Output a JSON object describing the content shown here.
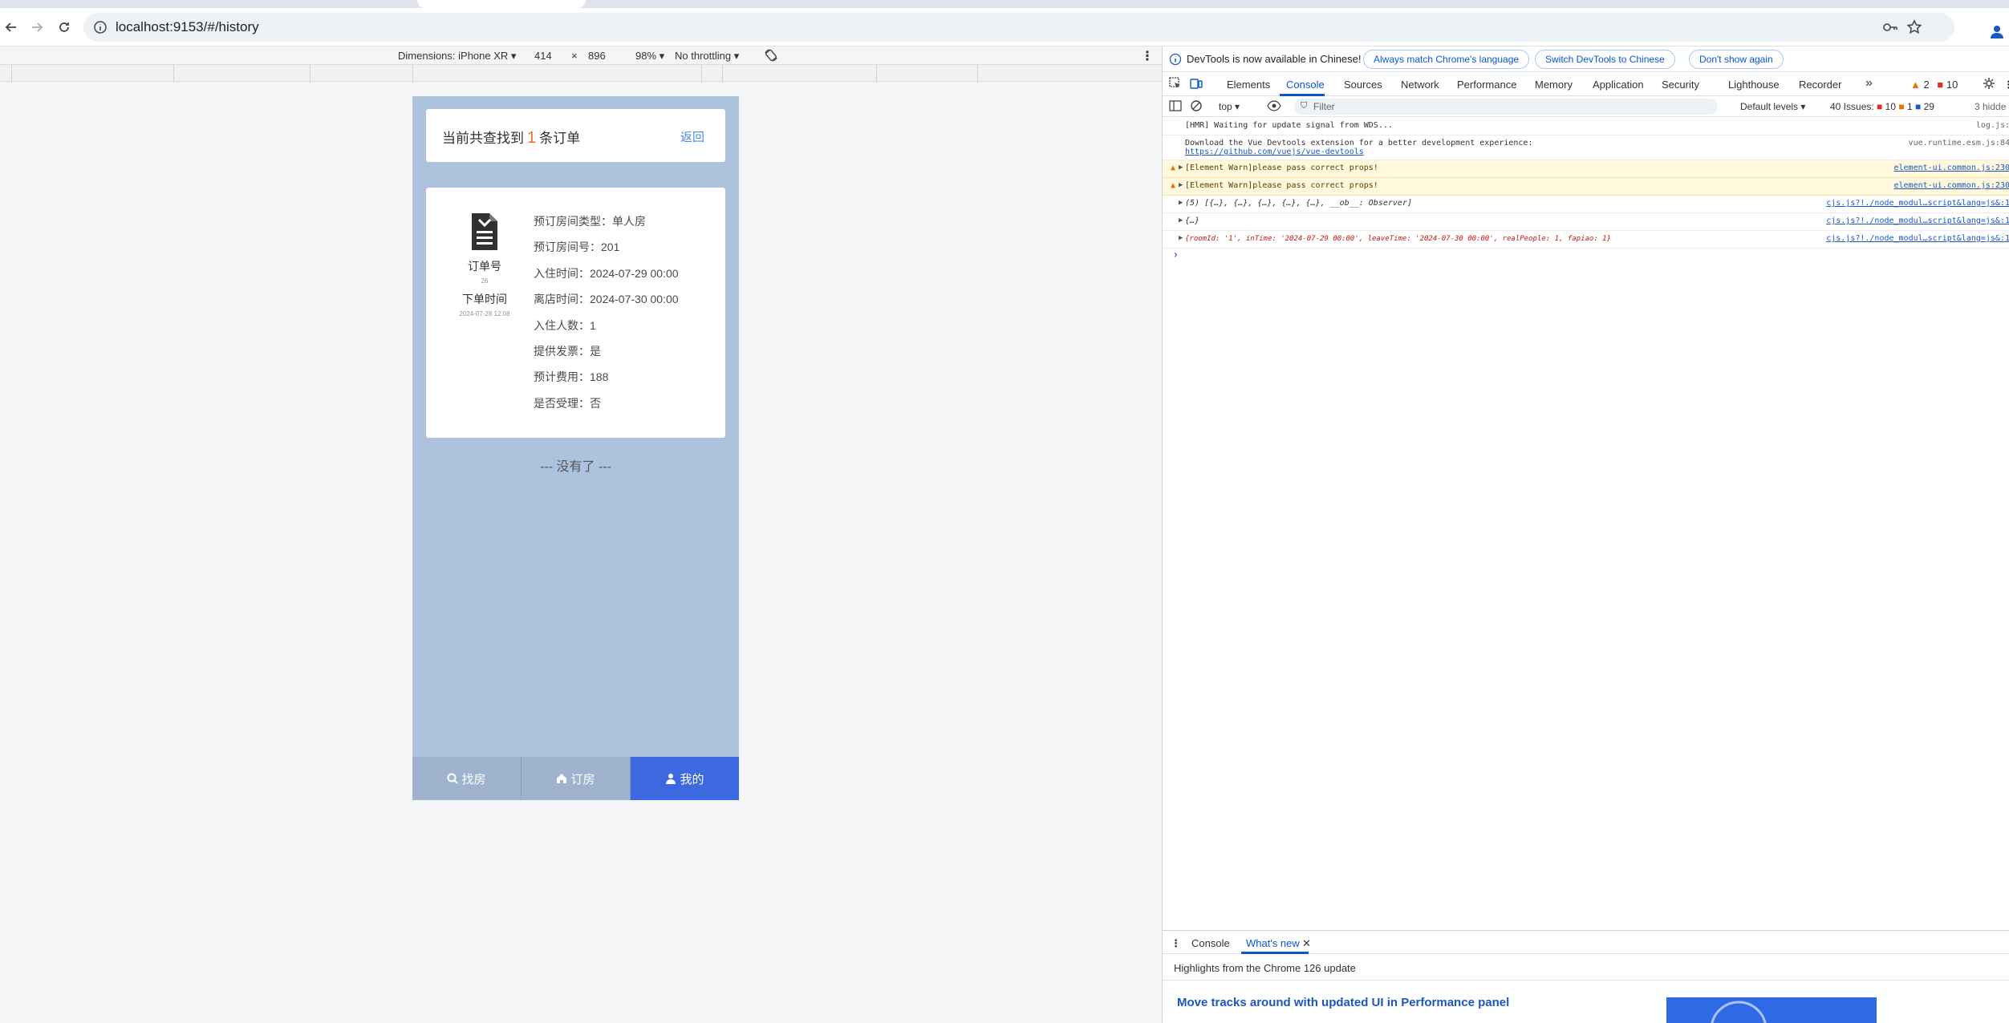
{
  "browser": {
    "url": "localhost:9153/#/history"
  },
  "device_toolbar": {
    "dimensions_label": "Dimensions: iPhone XR",
    "width": "414",
    "times": "×",
    "height": "896",
    "zoom": "98%",
    "throttling": "No throttling"
  },
  "app": {
    "summary_prefix": "当前共查找到",
    "summary_count": "1",
    "summary_suffix": "条订单",
    "back_link": "返回",
    "order": {
      "order_no_label": "订单号",
      "order_no_value": "26",
      "order_time_label": "下单时间",
      "order_time_value": "2024-07-28 12:08",
      "fields": [
        {
          "label": "预订房间类型：",
          "value": "单人房"
        },
        {
          "label": "预订房间号：",
          "value": "201"
        },
        {
          "label": "入住时间：",
          "value": "2024-07-29 00:00"
        },
        {
          "label": "离店时间：",
          "value": "2024-07-30 00:00"
        },
        {
          "label": "入住人数：",
          "value": "1"
        },
        {
          "label": "提供发票：",
          "value": "是"
        },
        {
          "label": "预计费用：",
          "value": "188"
        },
        {
          "label": "是否受理：",
          "value": "否"
        }
      ]
    },
    "no_more": "--- 没有了 ---",
    "tabbar": [
      {
        "label": "找房",
        "icon": "search-icon",
        "active": false
      },
      {
        "label": "订房",
        "icon": "home-icon",
        "active": false
      },
      {
        "label": "我的",
        "icon": "user-icon",
        "active": true
      }
    ],
    "colors": {
      "page_bg": "#adc2dd",
      "tab_active": "#3c68e0",
      "count_accent": "#f56c2c",
      "link": "#4a8be0"
    }
  },
  "devtools": {
    "banner": {
      "message": "DevTools is now available in Chinese!",
      "btn_match": "Always match Chrome's language",
      "btn_switch": "Switch DevTools to Chinese",
      "btn_dismiss": "Don't show again"
    },
    "tabs": [
      "Elements",
      "Console",
      "Sources",
      "Network",
      "Performance",
      "Memory",
      "Application",
      "Security",
      "Lighthouse",
      "Recorder"
    ],
    "more_tabs": "»",
    "warn_count": "2",
    "error_count": "10",
    "filter": {
      "context": "top",
      "placeholder": "Filter",
      "levels": "Default levels",
      "issues_label": "40 Issues:",
      "issues_err": "10",
      "issues_warn": "1",
      "issues_info": "29",
      "hidden": "3 hidde"
    },
    "console": [
      {
        "text": "[HMR] Waiting for update signal from WDS...",
        "src": "log.js:"
      },
      {
        "text": "Download the Vue Devtools extension for a better development experience:",
        "link": "https://github.com/vuejs/vue-devtools",
        "src": "vue.runtime.esm.js:84"
      },
      {
        "text": "[Element Warn]please pass correct props!",
        "src": "element-ui.common.js:230"
      },
      {
        "text": "[Element Warn]please pass correct props!",
        "src": "element-ui.common.js:230"
      },
      {
        "text": "(5) [{…}, {…}, {…}, {…}, {…}, __ob__: Observer]",
        "src": "cjs.js?!./node_modul…script&lang=js&:1"
      },
      {
        "text": "{…}",
        "src": "cjs.js?!./node_modul…script&lang=js&:1"
      },
      {
        "text": "{roomId: '1', inTime: '2024-07-29 00:00', leaveTime: '2024-07-30 00:00', realPeople: 1, fapiao: 1}",
        "src": "cjs.js?!./node_modul…script&lang=js&:1"
      }
    ],
    "drawer": {
      "tab_console": "Console",
      "tab_whatsnew": "What's new",
      "subtitle": "Highlights from the Chrome 126 update",
      "headline": "Move tracks around with updated UI in Performance panel"
    }
  }
}
